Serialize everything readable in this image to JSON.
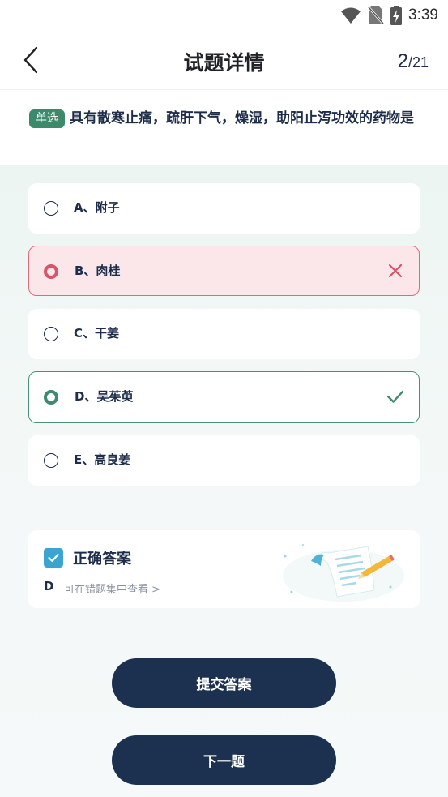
{
  "status_bar": {
    "time": "3:39",
    "icons": [
      "wifi-icon",
      "no-sim-icon",
      "battery-charging-icon"
    ]
  },
  "header": {
    "title": "试题详情",
    "progress_current": "2",
    "progress_total": "/21"
  },
  "question": {
    "type_badge": "单选",
    "text": "具有散寒止痛，疏肝下气，燥湿，助阳止泻功效的药物是"
  },
  "options": [
    {
      "label": "A、附子",
      "state": "normal"
    },
    {
      "label": "B、肉桂",
      "state": "wrong"
    },
    {
      "label": "C、干姜",
      "state": "normal"
    },
    {
      "label": "D、吴茱萸",
      "state": "correct"
    },
    {
      "label": "E、高良姜",
      "state": "normal"
    }
  ],
  "answer": {
    "title": "正确答案",
    "value": "D",
    "link": "可在错题集中查看 >"
  },
  "buttons": {
    "submit": "提交答案",
    "next": "下一题"
  },
  "colors": {
    "primary_dark": "#1c3150",
    "correct": "#3f8a6f",
    "wrong": "#d9536a",
    "check_blue": "#3aa5d0"
  }
}
